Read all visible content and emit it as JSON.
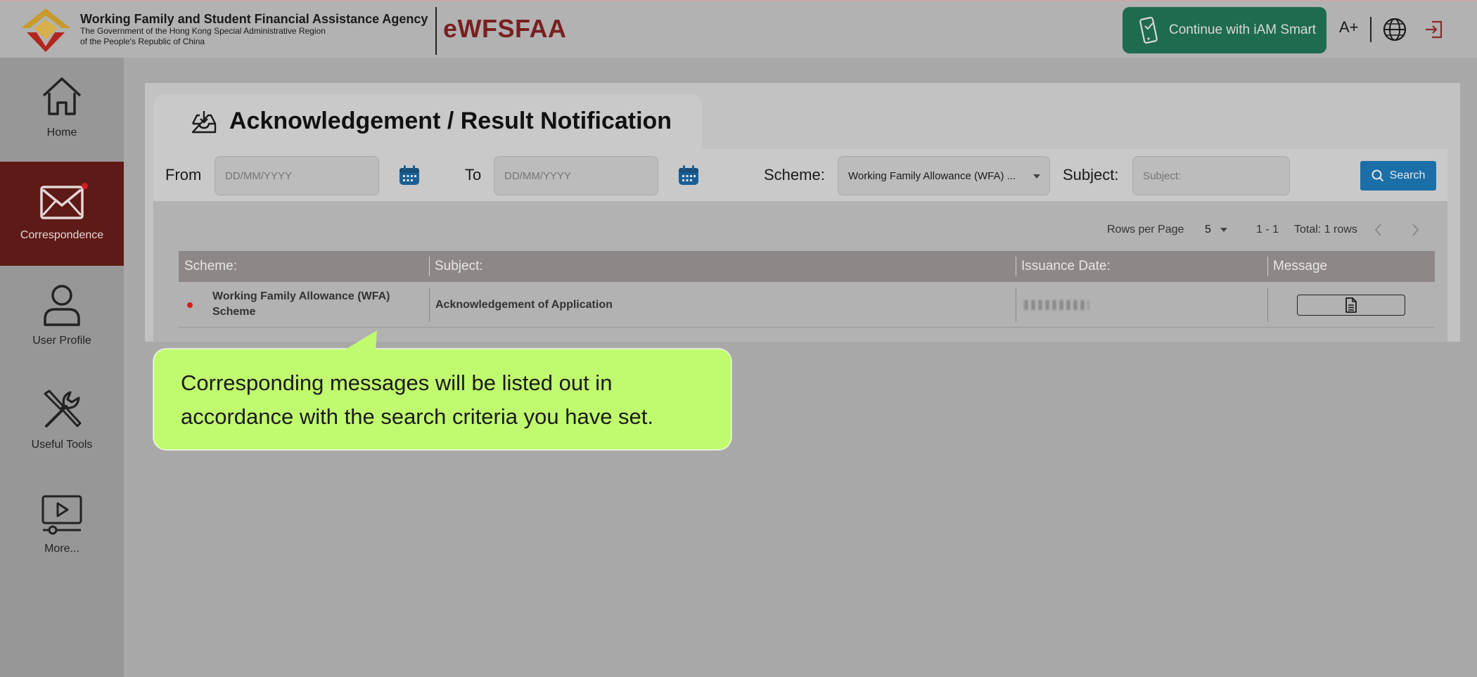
{
  "header": {
    "agency_name": "Working Family and Student Financial Assistance Agency",
    "agency_sub_line1": "The Government of the Hong Kong Special Administrative Region",
    "agency_sub_line2": "of the People's Republic of China",
    "brand": "eWFSFAA",
    "iam_smart_label": "Continue with iAM Smart",
    "font_size_label": "A+"
  },
  "sidebar": {
    "items": [
      {
        "label": "Home",
        "icon": "home-icon"
      },
      {
        "label": "Correspondence",
        "icon": "envelope-icon",
        "active": true
      },
      {
        "label": "User Profile",
        "icon": "user-icon"
      },
      {
        "label": "Useful Tools",
        "icon": "tools-icon"
      },
      {
        "label": "More...",
        "icon": "video-icon"
      }
    ]
  },
  "page": {
    "title": "Acknowledgement / Result Notification"
  },
  "filters": {
    "from_label": "From",
    "from_placeholder": "DD/MM/YYYY",
    "to_label": "To",
    "to_placeholder": "DD/MM/YYYY",
    "scheme_label": "Scheme:",
    "scheme_value": "Working Family Allowance (WFA) ...",
    "subject_label": "Subject:",
    "subject_placeholder": "Subject:",
    "search_label": "Search"
  },
  "pagination": {
    "rows_per_page_label": "Rows per Page",
    "rows_per_page_value": "5",
    "range": "1 - 1",
    "total": "Total: 1 rows"
  },
  "table": {
    "columns": [
      "Scheme:",
      "Subject:",
      "Issuance Date:",
      "Message"
    ],
    "rows": [
      {
        "scheme_line1": "Working Family Allowance (WFA)",
        "scheme_line2": "Scheme",
        "subject": "Acknowledgement of Application",
        "unread": true
      }
    ]
  },
  "callout": {
    "line1": "Corresponding messages will be listed out in",
    "line2": "accordance with the search criteria you have set."
  },
  "colors": {
    "brand": "#7a1f1f",
    "active_sidebar": "#5e1a16",
    "iam_smart": "#1f6b4f",
    "search_button": "#1b6fa8",
    "callout": "#c0fa6e",
    "unread_dot": "#d71d1d"
  }
}
